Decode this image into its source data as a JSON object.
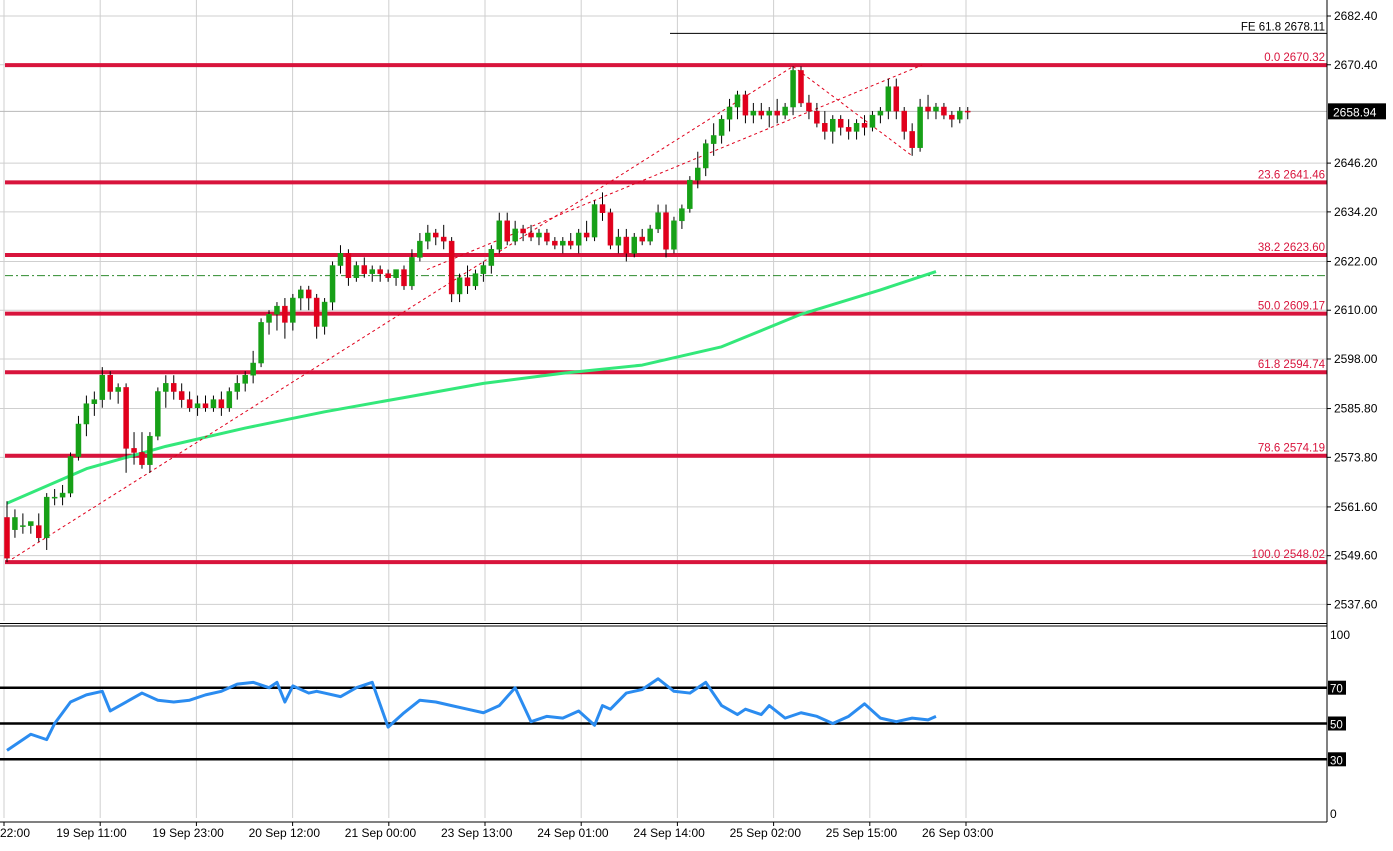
{
  "chart_data": [
    {
      "type": "candlestick",
      "panel": "price",
      "x_tick_labels": [
        "22:00",
        "19 Sep 11:00",
        "19 Sep 23:00",
        "20 Sep 12:00",
        "21 Sep 00:00",
        "23 Sep 13:00",
        "24 Sep 01:00",
        "24 Sep 14:00",
        "25 Sep 02:00",
        "25 Sep 15:00",
        "26 Sep 03:00"
      ],
      "y_tick_labels": [
        "2682.40",
        "2670.40",
        "2646.20",
        "2634.20",
        "2622.00",
        "2610.00",
        "2598.00",
        "2585.80",
        "2573.80",
        "2561.60",
        "2549.60",
        "2537.60"
      ],
      "ylim": [
        2531.0,
        2686.0
      ],
      "current_price_label": "2658.94",
      "current_price": 2658.94,
      "fibonacci_levels": [
        {
          "label": "0.0 2670.32",
          "value": 2670.32
        },
        {
          "label": "23.6 2641.46",
          "value": 2641.46
        },
        {
          "label": "38.2 2623.60",
          "value": 2623.6
        },
        {
          "label": "50.0 2609.17",
          "value": 2609.17
        },
        {
          "label": "61.8 2594.74",
          "value": 2594.74
        },
        {
          "label": "78.6 2574.19",
          "value": 2574.19
        },
        {
          "label": "100.0 2548.02",
          "value": 2548.02
        }
      ],
      "fib_extension": {
        "label": "FE 61.8 2678.11",
        "value": 2678.11
      },
      "reference_dashdot_level": 2618.5,
      "candles": [
        {
          "o": 2559,
          "h": 2563,
          "l": 2548,
          "c": 2549
        },
        {
          "o": 2556,
          "h": 2561,
          "l": 2554,
          "c": 2559
        },
        {
          "o": 2557,
          "h": 2560,
          "l": 2555,
          "c": 2557
        },
        {
          "o": 2557,
          "h": 2558,
          "l": 2555,
          "c": 2558
        },
        {
          "o": 2557,
          "h": 2560,
          "l": 2553,
          "c": 2554
        },
        {
          "o": 2554,
          "h": 2565,
          "l": 2551,
          "c": 2564
        },
        {
          "o": 2564,
          "h": 2566,
          "l": 2562,
          "c": 2564
        },
        {
          "o": 2564,
          "h": 2567,
          "l": 2562,
          "c": 2565
        },
        {
          "o": 2565,
          "h": 2575,
          "l": 2564,
          "c": 2574
        },
        {
          "o": 2574,
          "h": 2584,
          "l": 2573,
          "c": 2582
        },
        {
          "o": 2582,
          "h": 2589,
          "l": 2579,
          "c": 2587
        },
        {
          "o": 2587,
          "h": 2590,
          "l": 2584,
          "c": 2588
        },
        {
          "o": 2588,
          "h": 2596,
          "l": 2586,
          "c": 2594
        },
        {
          "o": 2594,
          "h": 2595,
          "l": 2588,
          "c": 2590
        },
        {
          "o": 2590,
          "h": 2592,
          "l": 2587,
          "c": 2591
        },
        {
          "o": 2591,
          "h": 2592,
          "l": 2570,
          "c": 2576
        },
        {
          "o": 2576,
          "h": 2580,
          "l": 2572,
          "c": 2575
        },
        {
          "o": 2575,
          "h": 2580,
          "l": 2571,
          "c": 2572
        },
        {
          "o": 2572,
          "h": 2580,
          "l": 2570,
          "c": 2579
        },
        {
          "o": 2579,
          "h": 2591,
          "l": 2578,
          "c": 2590
        },
        {
          "o": 2590,
          "h": 2594,
          "l": 2586,
          "c": 2592
        },
        {
          "o": 2592,
          "h": 2594,
          "l": 2588,
          "c": 2590
        },
        {
          "o": 2590,
          "h": 2592,
          "l": 2586,
          "c": 2588
        },
        {
          "o": 2588,
          "h": 2590,
          "l": 2585,
          "c": 2586
        },
        {
          "o": 2586,
          "h": 2589,
          "l": 2584,
          "c": 2587
        },
        {
          "o": 2587,
          "h": 2589,
          "l": 2585,
          "c": 2586
        },
        {
          "o": 2586,
          "h": 2589,
          "l": 2585,
          "c": 2588
        },
        {
          "o": 2588,
          "h": 2590,
          "l": 2584,
          "c": 2586
        },
        {
          "o": 2586,
          "h": 2591,
          "l": 2585,
          "c": 2590
        },
        {
          "o": 2590,
          "h": 2594,
          "l": 2588,
          "c": 2592
        },
        {
          "o": 2592,
          "h": 2595,
          "l": 2590,
          "c": 2594
        },
        {
          "o": 2594,
          "h": 2600,
          "l": 2592,
          "c": 2597
        },
        {
          "o": 2597,
          "h": 2608,
          "l": 2596,
          "c": 2607
        },
        {
          "o": 2607,
          "h": 2610,
          "l": 2604,
          "c": 2609
        },
        {
          "o": 2609,
          "h": 2612,
          "l": 2605,
          "c": 2611
        },
        {
          "o": 2611,
          "h": 2613,
          "l": 2603,
          "c": 2607
        },
        {
          "o": 2607,
          "h": 2614,
          "l": 2605,
          "c": 2613
        },
        {
          "o": 2613,
          "h": 2616,
          "l": 2610,
          "c": 2615
        },
        {
          "o": 2615,
          "h": 2616,
          "l": 2610,
          "c": 2613
        },
        {
          "o": 2613,
          "h": 2614,
          "l": 2603,
          "c": 2606
        },
        {
          "o": 2606,
          "h": 2613,
          "l": 2604,
          "c": 2612
        },
        {
          "o": 2612,
          "h": 2622,
          "l": 2610,
          "c": 2621
        },
        {
          "o": 2621,
          "h": 2626,
          "l": 2619,
          "c": 2624
        },
        {
          "o": 2624,
          "h": 2625,
          "l": 2616,
          "c": 2618
        },
        {
          "o": 2618,
          "h": 2622,
          "l": 2617,
          "c": 2621
        },
        {
          "o": 2621,
          "h": 2623,
          "l": 2618,
          "c": 2619
        },
        {
          "o": 2619,
          "h": 2621,
          "l": 2617,
          "c": 2620
        },
        {
          "o": 2620,
          "h": 2621,
          "l": 2617,
          "c": 2619
        },
        {
          "o": 2619,
          "h": 2620,
          "l": 2617,
          "c": 2618
        },
        {
          "o": 2618,
          "h": 2620,
          "l": 2616,
          "c": 2620
        },
        {
          "o": 2620,
          "h": 2621,
          "l": 2615,
          "c": 2616
        },
        {
          "o": 2616,
          "h": 2625,
          "l": 2615,
          "c": 2623
        },
        {
          "o": 2623,
          "h": 2629,
          "l": 2622,
          "c": 2627
        },
        {
          "o": 2627,
          "h": 2631,
          "l": 2625,
          "c": 2629
        },
        {
          "o": 2629,
          "h": 2630,
          "l": 2626,
          "c": 2628
        },
        {
          "o": 2628,
          "h": 2631,
          "l": 2625,
          "c": 2627
        },
        {
          "o": 2627,
          "h": 2628,
          "l": 2612,
          "c": 2614
        },
        {
          "o": 2614,
          "h": 2619,
          "l": 2612,
          "c": 2618
        },
        {
          "o": 2618,
          "h": 2621,
          "l": 2614,
          "c": 2616
        },
        {
          "o": 2616,
          "h": 2620,
          "l": 2615,
          "c": 2619
        },
        {
          "o": 2619,
          "h": 2622,
          "l": 2617,
          "c": 2621
        },
        {
          "o": 2621,
          "h": 2626,
          "l": 2619,
          "c": 2625
        },
        {
          "o": 2625,
          "h": 2634,
          "l": 2624,
          "c": 2632
        },
        {
          "o": 2632,
          "h": 2634,
          "l": 2626,
          "c": 2627
        },
        {
          "o": 2627,
          "h": 2632,
          "l": 2626,
          "c": 2630
        },
        {
          "o": 2630,
          "h": 2631,
          "l": 2627,
          "c": 2629
        },
        {
          "o": 2629,
          "h": 2631,
          "l": 2627,
          "c": 2628
        },
        {
          "o": 2628,
          "h": 2630,
          "l": 2626,
          "c": 2629
        },
        {
          "o": 2629,
          "h": 2630,
          "l": 2626,
          "c": 2627
        },
        {
          "o": 2627,
          "h": 2628,
          "l": 2625,
          "c": 2626
        },
        {
          "o": 2626,
          "h": 2628,
          "l": 2624,
          "c": 2627
        },
        {
          "o": 2627,
          "h": 2629,
          "l": 2625,
          "c": 2626
        },
        {
          "o": 2626,
          "h": 2630,
          "l": 2624,
          "c": 2629
        },
        {
          "o": 2629,
          "h": 2632,
          "l": 2627,
          "c": 2628
        },
        {
          "o": 2628,
          "h": 2637,
          "l": 2627,
          "c": 2636
        },
        {
          "o": 2636,
          "h": 2639,
          "l": 2632,
          "c": 2634
        },
        {
          "o": 2634,
          "h": 2635,
          "l": 2625,
          "c": 2626
        },
        {
          "o": 2626,
          "h": 2630,
          "l": 2624,
          "c": 2628
        },
        {
          "o": 2628,
          "h": 2630,
          "l": 2622,
          "c": 2624
        },
        {
          "o": 2624,
          "h": 2629,
          "l": 2623,
          "c": 2628
        },
        {
          "o": 2628,
          "h": 2630,
          "l": 2626,
          "c": 2627
        },
        {
          "o": 2627,
          "h": 2631,
          "l": 2626,
          "c": 2630
        },
        {
          "o": 2630,
          "h": 2636,
          "l": 2629,
          "c": 2634
        },
        {
          "o": 2634,
          "h": 2636,
          "l": 2623,
          "c": 2625
        },
        {
          "o": 2625,
          "h": 2633,
          "l": 2624,
          "c": 2632
        },
        {
          "o": 2632,
          "h": 2636,
          "l": 2630,
          "c": 2635
        },
        {
          "o": 2635,
          "h": 2643,
          "l": 2634,
          "c": 2642
        },
        {
          "o": 2642,
          "h": 2649,
          "l": 2640,
          "c": 2645
        },
        {
          "o": 2645,
          "h": 2652,
          "l": 2643,
          "c": 2651
        },
        {
          "o": 2651,
          "h": 2656,
          "l": 2648,
          "c": 2653
        },
        {
          "o": 2653,
          "h": 2658,
          "l": 2651,
          "c": 2657
        },
        {
          "o": 2657,
          "h": 2662,
          "l": 2654,
          "c": 2660
        },
        {
          "o": 2660,
          "h": 2664,
          "l": 2657,
          "c": 2663
        },
        {
          "o": 2663,
          "h": 2664,
          "l": 2656,
          "c": 2658
        },
        {
          "o": 2658,
          "h": 2661,
          "l": 2656,
          "c": 2659
        },
        {
          "o": 2659,
          "h": 2661,
          "l": 2657,
          "c": 2658
        },
        {
          "o": 2658,
          "h": 2660,
          "l": 2655,
          "c": 2659
        },
        {
          "o": 2659,
          "h": 2662,
          "l": 2656,
          "c": 2658
        },
        {
          "o": 2658,
          "h": 2661,
          "l": 2657,
          "c": 2660
        },
        {
          "o": 2660,
          "h": 2670,
          "l": 2658,
          "c": 2669
        },
        {
          "o": 2669,
          "h": 2670,
          "l": 2660,
          "c": 2661
        },
        {
          "o": 2661,
          "h": 2663,
          "l": 2657,
          "c": 2659
        },
        {
          "o": 2659,
          "h": 2661,
          "l": 2655,
          "c": 2656
        },
        {
          "o": 2656,
          "h": 2659,
          "l": 2652,
          "c": 2654
        },
        {
          "o": 2654,
          "h": 2658,
          "l": 2651,
          "c": 2657
        },
        {
          "o": 2657,
          "h": 2658,
          "l": 2653,
          "c": 2655
        },
        {
          "o": 2655,
          "h": 2657,
          "l": 2652,
          "c": 2654
        },
        {
          "o": 2654,
          "h": 2657,
          "l": 2652,
          "c": 2656
        },
        {
          "o": 2656,
          "h": 2658,
          "l": 2653,
          "c": 2655
        },
        {
          "o": 2655,
          "h": 2659,
          "l": 2654,
          "c": 2658
        },
        {
          "o": 2658,
          "h": 2660,
          "l": 2656,
          "c": 2659
        },
        {
          "o": 2659,
          "h": 2667,
          "l": 2657,
          "c": 2665
        },
        {
          "o": 2665,
          "h": 2667,
          "l": 2657,
          "c": 2659
        },
        {
          "o": 2659,
          "h": 2660,
          "l": 2652,
          "c": 2654
        },
        {
          "o": 2654,
          "h": 2656,
          "l": 2648,
          "c": 2650
        },
        {
          "o": 2650,
          "h": 2662,
          "l": 2649,
          "c": 2660
        },
        {
          "o": 2660,
          "h": 2663,
          "l": 2657,
          "c": 2659
        },
        {
          "o": 2659,
          "h": 2661,
          "l": 2657,
          "c": 2660
        },
        {
          "o": 2660,
          "h": 2661,
          "l": 2657,
          "c": 2658
        },
        {
          "o": 2658,
          "h": 2659,
          "l": 2655,
          "c": 2657
        },
        {
          "o": 2657,
          "h": 2660,
          "l": 2656,
          "c": 2659
        },
        {
          "o": 2659,
          "h": 2660,
          "l": 2657,
          "c": 2658.94
        }
      ],
      "moving_average": {
        "x_index": [
          0,
          10,
          20,
          30,
          40,
          50,
          60,
          70,
          80,
          90,
          100,
          110,
          117
        ],
        "values": [
          2562.5,
          2571.0,
          2576.5,
          2581.0,
          2585.0,
          2588.5,
          2592.0,
          2594.5,
          2596.5,
          2601.0,
          2609.0,
          2615.0,
          2619.5
        ],
        "color": "#33E87A"
      },
      "colors": {
        "bull": "#17A017",
        "bear": "#E0001C",
        "fib": "#D8143C",
        "grid": "#CFCFCF"
      }
    },
    {
      "type": "line",
      "panel": "rsi",
      "y_tick_labels": [
        "100",
        "0"
      ],
      "ylim": [
        0,
        100
      ],
      "levels": [
        70,
        50,
        30
      ],
      "level_labels": [
        "70",
        "50",
        "30"
      ],
      "series": [
        {
          "x_index": [
            0,
            3,
            5,
            6,
            8,
            10,
            12,
            13,
            15,
            17,
            19,
            21,
            23,
            25,
            27,
            29,
            31,
            33,
            34,
            35,
            36,
            38,
            39,
            40,
            42,
            44,
            46,
            48,
            50,
            52,
            54,
            56,
            58,
            60,
            62,
            64,
            66,
            68,
            70,
            72,
            74,
            75,
            76,
            78,
            80,
            82,
            84,
            86,
            88,
            90,
            92,
            93,
            95,
            96,
            98,
            100,
            102,
            104,
            106,
            108,
            110,
            112,
            114,
            116,
            117
          ],
          "values": [
            35,
            44,
            41,
            50,
            62,
            66,
            68,
            57,
            62,
            67,
            63,
            62,
            63,
            66,
            68,
            72,
            73,
            70,
            73,
            62,
            71,
            67,
            68,
            67,
            65,
            70,
            73,
            48,
            56,
            63,
            62,
            60,
            58,
            56,
            60,
            70,
            51,
            54,
            53,
            57,
            49,
            60,
            58,
            67,
            69,
            75,
            68,
            67,
            73,
            60,
            55,
            58,
            55,
            60,
            53,
            56,
            54,
            50,
            54,
            61,
            53,
            51,
            53,
            52,
            54
          ],
          "color": "#2B8CF0"
        }
      ]
    }
  ]
}
